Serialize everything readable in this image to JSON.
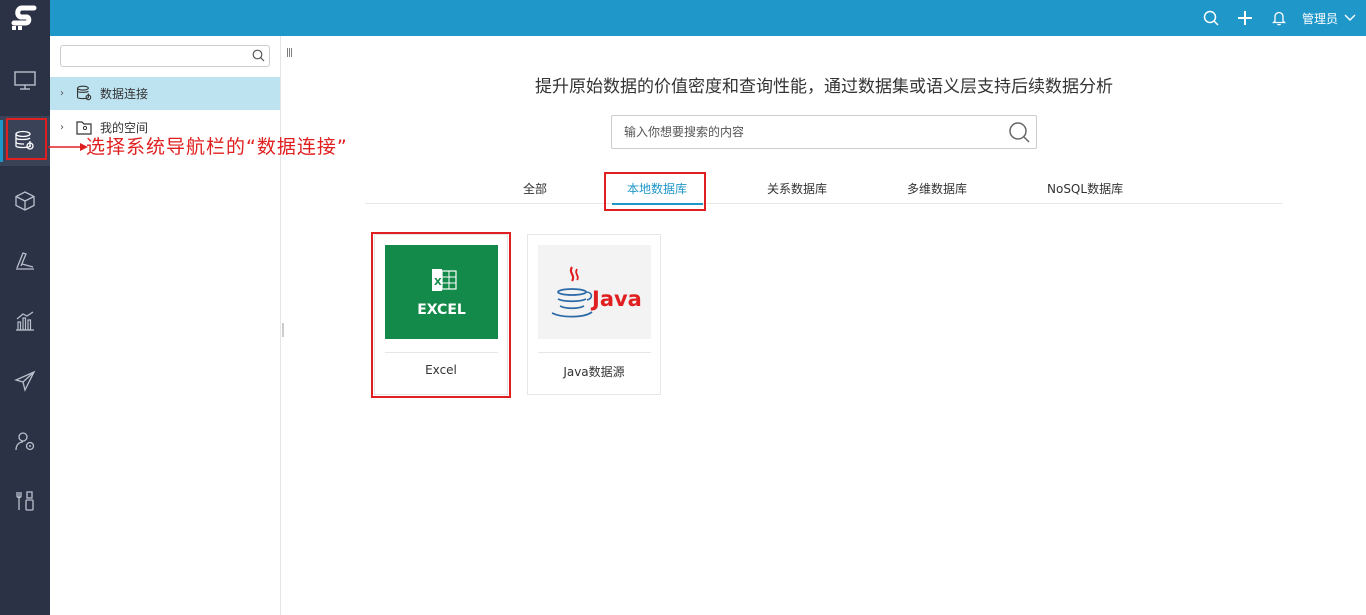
{
  "topbar": {
    "user_label": "管理员"
  },
  "tree": {
    "search_placeholder": "",
    "items": [
      {
        "label": "数据连接"
      },
      {
        "label": "我的空间"
      }
    ]
  },
  "annotation": {
    "text": "选择系统导航栏的“数据连接”"
  },
  "main": {
    "headline": "提升原始数据的价值密度和查询性能，通过数据集或语义层支持后续数据分析",
    "search_placeholder": "输入你想要搜索的内容",
    "tabs": [
      {
        "label": "全部"
      },
      {
        "label": "本地数据库"
      },
      {
        "label": "关系数据库"
      },
      {
        "label": "多维数据库"
      },
      {
        "label": "NoSQL数据库"
      }
    ],
    "active_tab": "本地数据库",
    "cards": [
      {
        "name": "Excel",
        "thumb_text": "EXCEL"
      },
      {
        "name": "Java数据源",
        "thumb_text": "Java"
      }
    ]
  },
  "colors": {
    "topbar": "#1f97c9",
    "sidebar": "#2b3245",
    "accent": "#1f97c9",
    "highlight": "#e02020",
    "excel_green": "#138a4a"
  }
}
